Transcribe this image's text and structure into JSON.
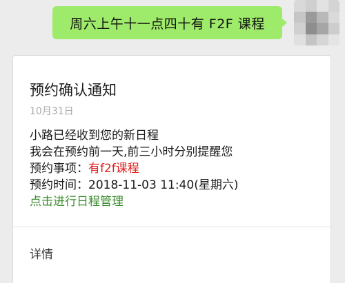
{
  "chat": {
    "message": "周六上午十一点四十有 F2F 课程",
    "avatar_icon": "blurred-avatar-icon",
    "bubble_color": "#9eea6a"
  },
  "card": {
    "title": "预约确认通知",
    "date": "10月31日",
    "line1": "小路已经收到您的新日程",
    "line2": "我会在预约前一天,前三小时分别提醒您",
    "item_label": "预约事项：",
    "item_value": "有f2f课程",
    "time_label": "预约时间：",
    "time_value": "2018-11-03 11:40(星期六)",
    "manage_link": "点击进行日程管理",
    "detail_link": "详情",
    "accent_red": "#e02020",
    "accent_green": "#3c8d2f"
  }
}
